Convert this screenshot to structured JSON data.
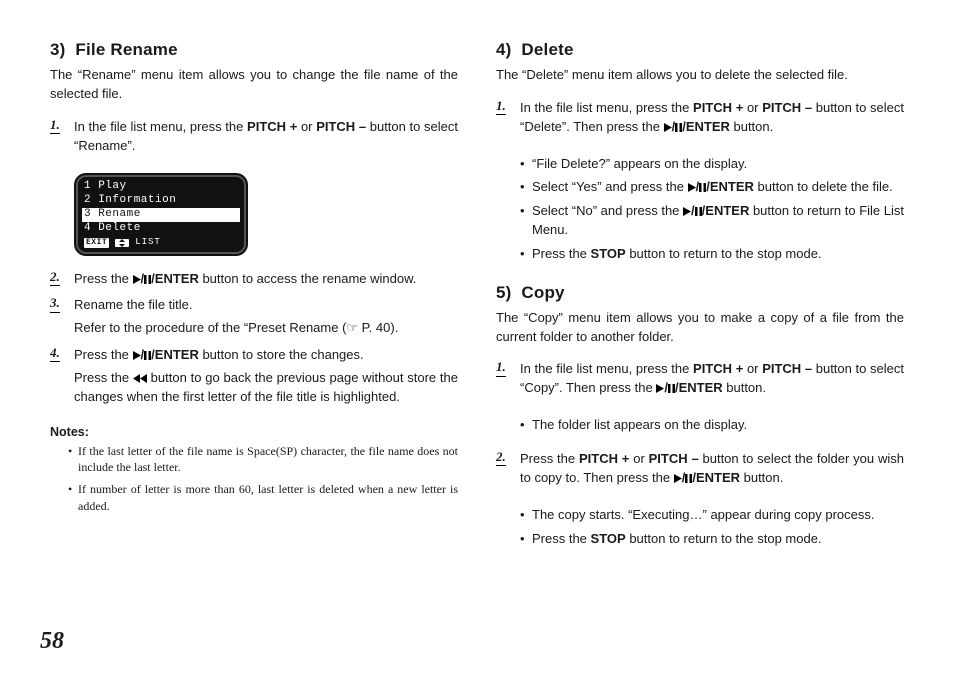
{
  "page_number": "58",
  "left": {
    "section_num": "3)",
    "section_title": "File Rename",
    "intro": "The “Rename” menu item allows you to change the file name of the selected file.",
    "lcd": {
      "rows": [
        {
          "text": "1 Play",
          "selected": false
        },
        {
          "text": "2 Information",
          "selected": false
        },
        {
          "text": "3 Rename",
          "selected": true
        },
        {
          "text": "4 Delete",
          "selected": false
        }
      ],
      "footer_exit": "EXIT",
      "footer_list": "LIST"
    },
    "step1_a": "In the file list menu, press the ",
    "step1_b": "PITCH +",
    "step1_c": " or ",
    "step1_d": "PITCH –",
    "step1_e": " button to select “Rename”.",
    "step2_a": "Press the ",
    "step2_enter": "ENTER",
    "step2_b": " button to access the rename window.",
    "step3_a": "Rename the file title.",
    "step3_sub": "Refer to the procedure of the “Preset Rename (☞ P. 40).",
    "step4_a": "Press the ",
    "step4_b": " button to store the changes.",
    "step4_sub_a": "Press the ",
    "step4_sub_b": " button to go back the previous page without store the changes when the first letter of the file title is highlighted.",
    "notes_heading": "Notes:",
    "notes": [
      "If the last letter of the file name is Space(SP) character, the file name does not include the last letter.",
      "If number of letter is more than 60, last letter is deleted when a new letter is added."
    ]
  },
  "right": {
    "section4_num": "4)",
    "section4_title": "Delete",
    "section4_intro": "The “Delete” menu item allows you to delete the selected file.",
    "s4_step1_a": "In the file list menu, press the ",
    "s4_step1_b": "PITCH +",
    "s4_step1_c": " or ",
    "s4_step1_d": "PITCH –",
    "s4_step1_e": " button to select “Delete”. Then press the ",
    "s4_step1_f": " button.",
    "s4_bullets": {
      "b1": "“File Delete?” appears on the display.",
      "b2_a": "Select “Yes” and press the ",
      "b2_b": " button to delete the file.",
      "b3_a": "Select “No” and press the ",
      "b3_b": " button to return to File List Menu.",
      "b4_a": "Press the ",
      "b4_stop": "STOP",
      "b4_b": " button to return to the stop mode."
    },
    "section5_num": "5)",
    "section5_title": "Copy",
    "section5_intro": "The “Copy” menu item allows you to make a copy of a file from the current folder to another folder.",
    "s5_step1_a": "In the file list menu, press the ",
    "s5_step1_b": "PITCH +",
    "s5_step1_c": " or ",
    "s5_step1_d": "PITCH –",
    "s5_step1_e": " button to select “Copy”. Then press the ",
    "s5_step1_f": " button.",
    "s5_b1": "The folder list appears on the display.",
    "s5_step2_a": "Press the ",
    "s5_step2_b": "PITCH +",
    "s5_step2_c": " or ",
    "s5_step2_d": "PITCH –",
    "s5_step2_e": " button to select the folder you wish to copy to. Then press the ",
    "s5_step2_f": " button.",
    "s5_b2": "The copy starts. “Executing…” appear during copy process.",
    "s5_b3_a": "Press the ",
    "s5_b3_stop": "STOP",
    "s5_b3_b": " button to return to the stop mode.",
    "enter": "ENTER"
  }
}
